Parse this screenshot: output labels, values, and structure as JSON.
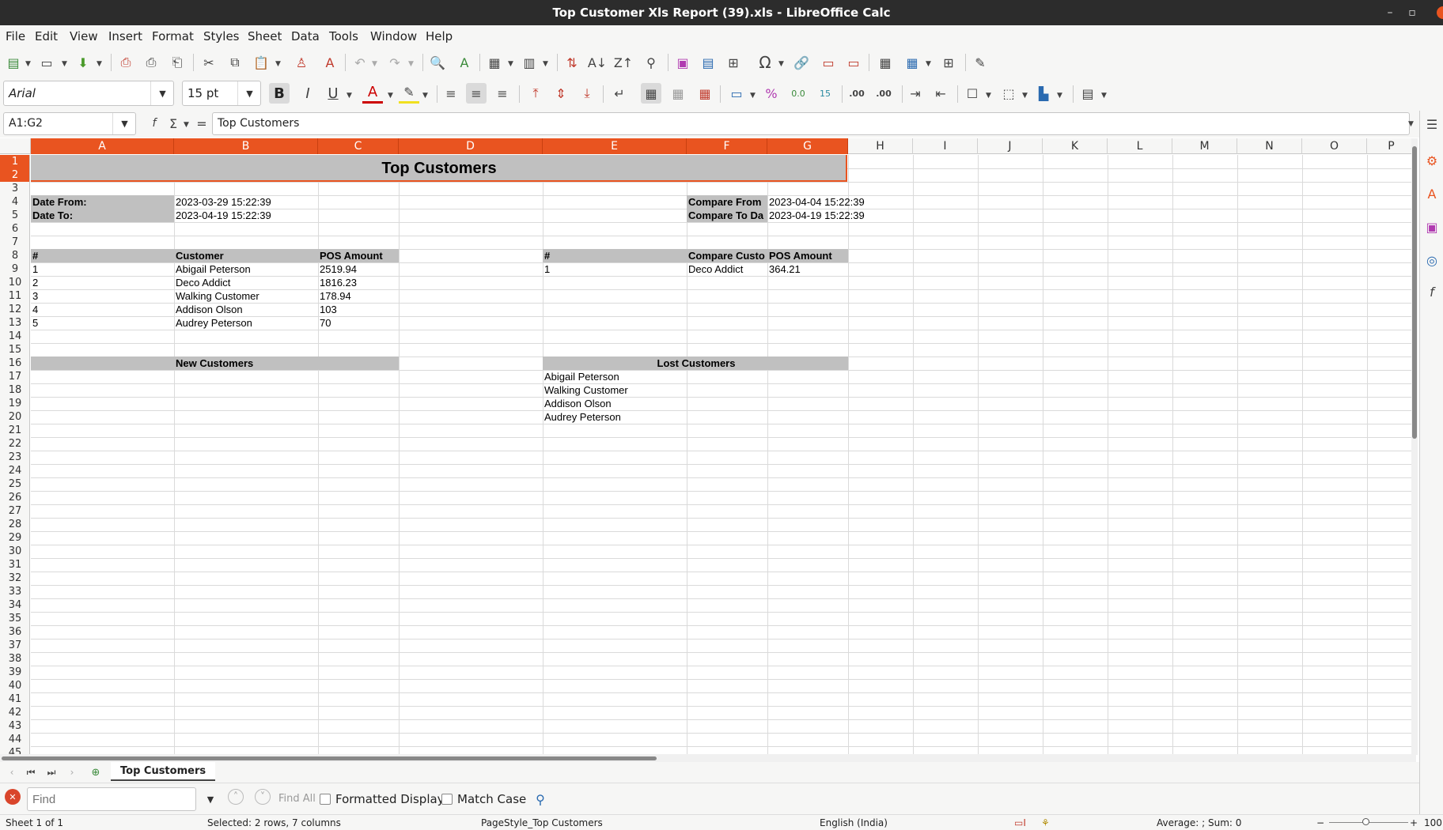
{
  "window": {
    "title": "Top Customer Xls Report (39).xls - LibreOffice Calc"
  },
  "menu": [
    "File",
    "Edit",
    "View",
    "Insert",
    "Format",
    "Styles",
    "Sheet",
    "Data",
    "Tools",
    "Window",
    "Help"
  ],
  "format": {
    "font_name": "Arial",
    "font_size": "15 pt"
  },
  "formula_bar": {
    "name_box": "A1:G2",
    "content": "Top Customers"
  },
  "columns": [
    "A",
    "B",
    "C",
    "D",
    "E",
    "F",
    "G",
    "H",
    "I",
    "J",
    "K",
    "L",
    "M",
    "N",
    "O",
    "P"
  ],
  "rows": [
    "1",
    "2",
    "3",
    "4",
    "5",
    "6",
    "7",
    "8",
    "9",
    "10",
    "11",
    "12",
    "13",
    "14",
    "15",
    "16",
    "17",
    "18",
    "19",
    "20",
    "21",
    "22",
    "23",
    "24",
    "25",
    "26",
    "27",
    "28",
    "29",
    "30",
    "31",
    "32",
    "33",
    "34",
    "35",
    "36",
    "37",
    "38",
    "39",
    "40",
    "41",
    "42",
    "43",
    "44",
    "45"
  ],
  "sheet": {
    "title": "Top Customers",
    "date_from_label": "Date From:",
    "date_from": "2023-03-29 15:22:39",
    "date_to_label": "Date To:",
    "date_to": "2023-04-19 15:22:39",
    "compare_from_label": "Compare From",
    "compare_from": "2023-04-04 15:22:39",
    "compare_to_label": "Compare To Da",
    "compare_to": "2023-04-19 15:22:39",
    "table1_headers": [
      "#",
      "Customer",
      "POS Amount"
    ],
    "table1_rows": [
      [
        "1",
        "Abigail Peterson",
        "2519.94"
      ],
      [
        "2",
        "Deco Addict",
        "1816.23"
      ],
      [
        "3",
        "Walking Customer",
        "178.94"
      ],
      [
        "4",
        "Addison Olson",
        "103"
      ],
      [
        "5",
        "Audrey Peterson",
        "70"
      ]
    ],
    "table2_headers": [
      "#",
      "Compare Custo",
      "POS Amount"
    ],
    "table2_rows": [
      [
        "1",
        "Deco Addict",
        "364.21"
      ]
    ],
    "new_customers_label": "New Customers",
    "lost_customers_label": "Lost Customers",
    "lost_customers": [
      "Abigail Peterson",
      "Walking Customer",
      "Addison Olson",
      "Audrey Peterson"
    ]
  },
  "sheet_tab": "Top Customers",
  "find": {
    "placeholder": "Find",
    "find_all": "Find All",
    "formatted_display": "Formatted Display",
    "match_case": "Match Case"
  },
  "status": {
    "sheet": "Sheet 1 of 1",
    "selection": "Selected: 2 rows, 7 columns",
    "page_style": "PageStyle_Top Customers",
    "language": "English (India)",
    "summary": "Average: ; Sum: 0",
    "zoom": "100"
  },
  "colors": {
    "accent": "#e95420",
    "header_gray": "#c0c0c0",
    "titlebar": "#2c2c2c"
  }
}
